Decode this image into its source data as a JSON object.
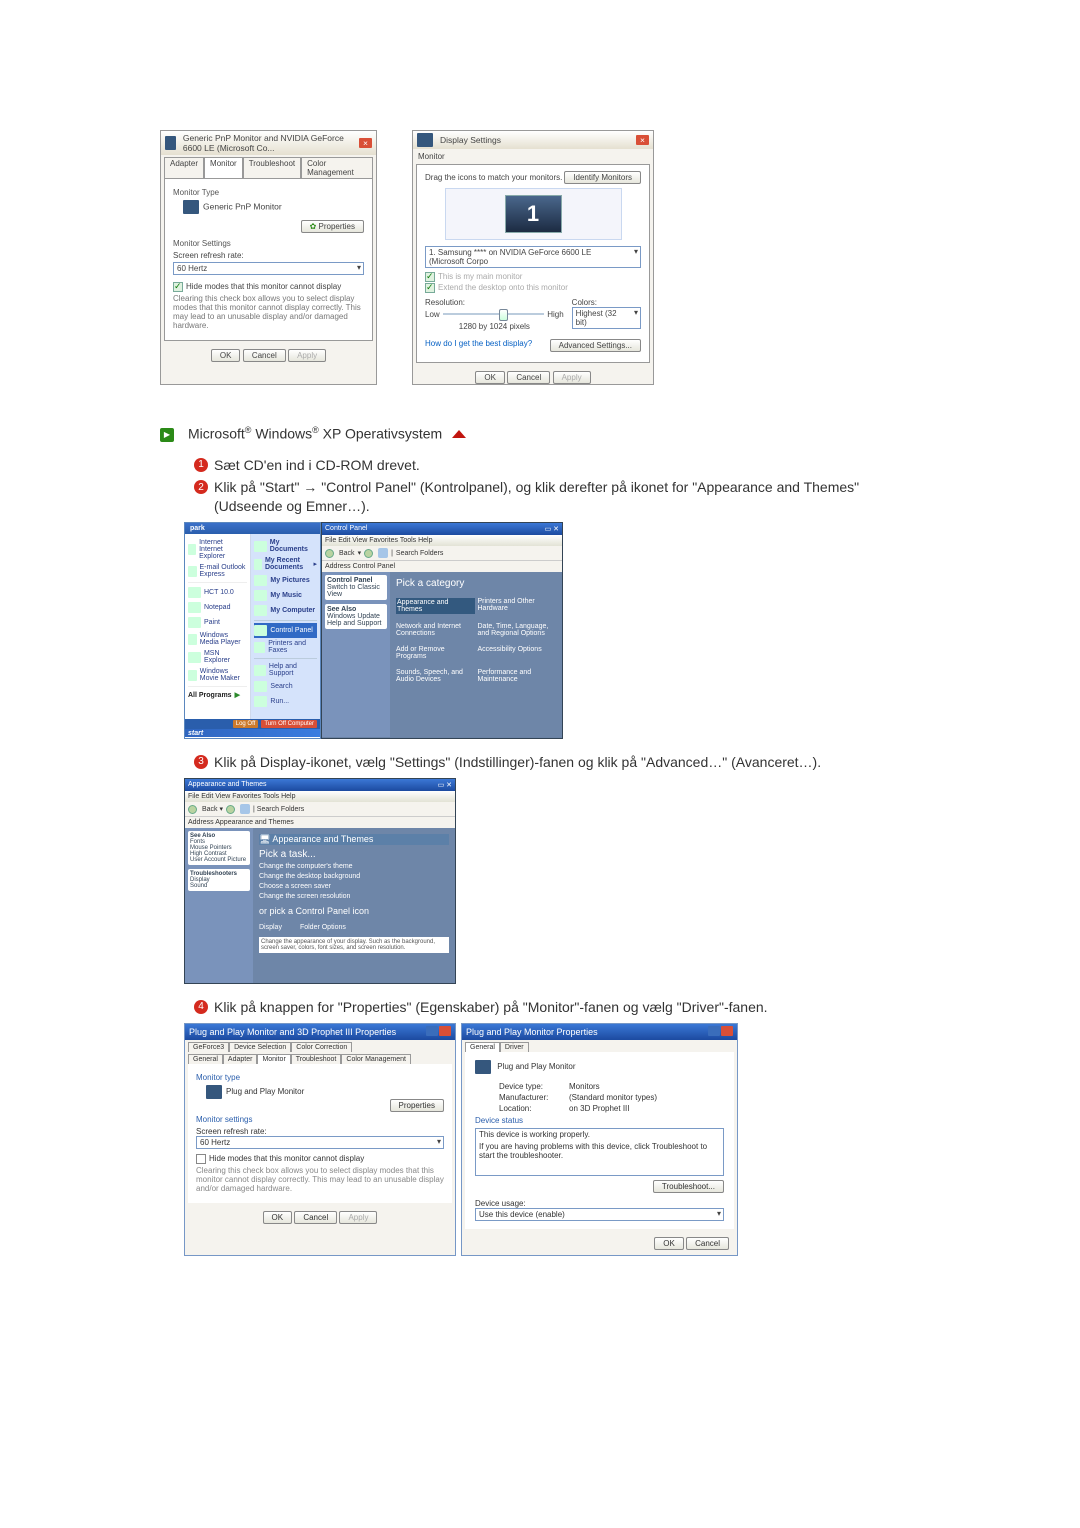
{
  "dlg1": {
    "title": "Generic PnP Monitor and NVIDIA GeForce 6600 LE (Microsoft Co...",
    "tabs": [
      "Adapter",
      "Monitor",
      "Troubleshoot",
      "Color Management"
    ],
    "grp1": "Monitor Type",
    "monitor_name": "Generic PnP Monitor",
    "properties_btn": "Properties",
    "grp2": "Monitor Settings",
    "refresh_lbl": "Screen refresh rate:",
    "refresh_val": "60 Hertz",
    "hide_chk": "Hide modes that this monitor cannot display",
    "hide_txt": "Clearing this check box allows you to select display modes that this monitor cannot display correctly. This may lead to an unusable display and/or damaged hardware.",
    "ok": "OK",
    "cancel": "Cancel",
    "apply": "Apply"
  },
  "dlg2": {
    "title": "Display Settings",
    "tab": "Monitor",
    "drag": "Drag the icons to match your monitors.",
    "identify": "Identify Monitors",
    "mon_num": "1",
    "mon_sel": "1. Samsung **** on NVIDIA GeForce 6600 LE (Microsoft Corpo",
    "chk1": "This is my main monitor",
    "chk2": "Extend the desktop onto this monitor",
    "res_lbl": "Resolution:",
    "low": "Low",
    "high": "High",
    "res_val": "1280 by 1024 pixels",
    "col_lbl": "Colors:",
    "col_val": "Highest (32 bit)",
    "help": "How do I get the best display?",
    "adv": "Advanced Settings...",
    "ok": "OK",
    "cancel": "Cancel",
    "apply": "Apply"
  },
  "section": {
    "title_pre": "Microsoft",
    "title_mid": " Windows",
    "title_suf": " XP Operativsystem"
  },
  "step1": "Sæt CD'en ind i CD-ROM drevet.",
  "step2": "Klik på \"Start\" → \"Control Panel\" (Kontrolpanel), og klik derefter på ikonet for \"Appearance and Themes\" (Udseende og Emner…).",
  "xp": {
    "user": "park",
    "left": [
      "Internet\nInternet Explorer",
      "E-mail\nOutlook Express",
      "HCT 10.0",
      "Notepad",
      "Paint",
      "Windows Media Player",
      "MSN Explorer",
      "Windows Movie Maker"
    ],
    "all_prog": "All Programs",
    "right": [
      "My Documents",
      "My Recent Documents",
      "My Pictures",
      "My Music",
      "My Computer",
      "Control Panel",
      "Printers and Faxes",
      "Help and Support",
      "Search",
      "Run..."
    ],
    "sel": "Control Panel",
    "logoff": "Log Off",
    "shutdown": "Turn Off Computer",
    "taskbar": "start"
  },
  "cat": {
    "title": "Control Panel",
    "menus": "File  Edit  View  Favorites  Tools  Help",
    "back": "Back",
    "tb": "Search  Folders",
    "addr": "Address  Control Panel",
    "side_hdr": "Control Panel",
    "side1": "Switch to Classic View",
    "see": "See Also",
    "see1": "Windows Update",
    "see2": "Help and Support",
    "pick": "Pick a category",
    "items": [
      "Appearance and Themes",
      "Network and Internet Connections",
      "Add or Remove Programs",
      "Sounds, Speech, and Audio Devices",
      "Printers and Other Hardware",
      "Date, Time, Language, and Regional Options",
      "Accessibility Options",
      "Performance and Maintenance"
    ]
  },
  "step3": "Klik på Display-ikonet, vælg \"Settings\" (Indstillinger)-fanen og klik på \"Advanced…\" (Avanceret…).",
  "cat2": {
    "title": "Appearance and Themes",
    "addr": "Address  Appearance and Themes",
    "pick": "Pick a task...",
    "tasks": [
      "Change the computer's theme",
      "Change the desktop background",
      "Choose a screen saver",
      "Change the screen resolution"
    ],
    "or": "or pick a Control Panel icon",
    "icons": [
      "Display",
      "Folder Options"
    ],
    "hint": "Change the appearance of your display. Such as the background, screen saver, colors, font sizes, and screen resolution."
  },
  "step4": "Klik på knappen for \"Properties\" (Egenskaber) på \"Monitor\"-fanen og vælg \"Driver\"-fanen.",
  "dlg3": {
    "title": "Plug and Play Monitor and 3D Prophet III Properties",
    "tabs_r1": [
      "GeForce3",
      "Device Selection",
      "Color Correction"
    ],
    "tabs_r2": [
      "General",
      "Adapter",
      "Monitor",
      "Troubleshoot",
      "Color Management"
    ],
    "grp1": "Monitor type",
    "mtype": "Plug and Play Monitor",
    "prop": "Properties",
    "grp2": "Monitor settings",
    "refresh_lbl": "Screen refresh rate:",
    "refresh_val": "60 Hertz",
    "hide": "Hide modes that this monitor cannot display",
    "hide_txt": "Clearing this check box allows you to select display modes that this monitor cannot display correctly. This may lead to an unusable display and/or damaged hardware.",
    "ok": "OK",
    "cancel": "Cancel",
    "apply": "Apply"
  },
  "dlg4": {
    "title": "Plug and Play Monitor Properties",
    "tabs": [
      "General",
      "Driver"
    ],
    "head": "Plug and Play Monitor",
    "dt_lbl": "Device type:",
    "dt_val": "Monitors",
    "mf_lbl": "Manufacturer:",
    "mf_val": "(Standard monitor types)",
    "loc_lbl": "Location:",
    "loc_val": "on 3D Prophet III",
    "ds_lbl": "Device status",
    "ds_txt": "This device is working properly.",
    "ds_help": "If you are having problems with this device, click Troubleshoot to start the troubleshooter.",
    "ts": "Troubleshoot...",
    "du_lbl": "Device usage:",
    "du_val": "Use this device (enable)",
    "ok": "OK",
    "cancel": "Cancel"
  }
}
